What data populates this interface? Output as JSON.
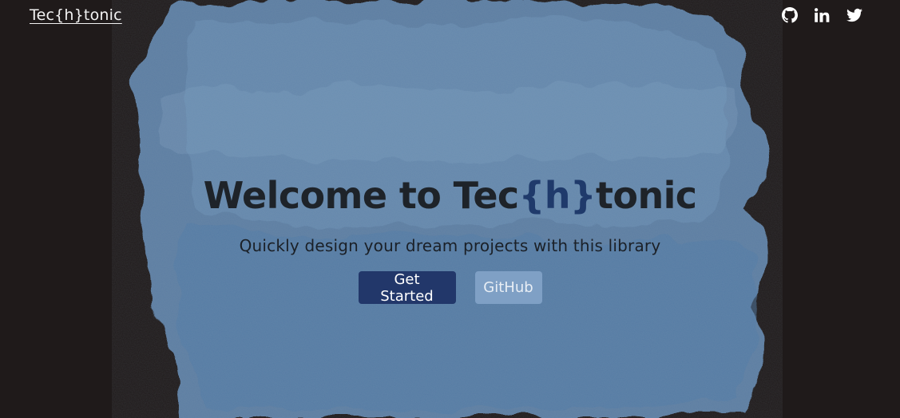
{
  "header": {
    "brand": "Tec{h}tonic",
    "social": [
      {
        "icon": "github-icon"
      },
      {
        "icon": "linkedin-icon"
      },
      {
        "icon": "twitter-icon"
      }
    ]
  },
  "hero": {
    "title_prefix": "Welcome to Tec",
    "title_accent": "{h}",
    "title_suffix": "tonic",
    "subtitle": "Quickly design your dream projects with this library",
    "primary_button": "Get Started",
    "secondary_button": "GitHub"
  },
  "colors": {
    "background": "#1f1a1a",
    "watercolor": "#5f83a8",
    "accent": "#1f3a6b",
    "primary_button": "#22376a",
    "secondary_button": "#7fa0c5"
  }
}
